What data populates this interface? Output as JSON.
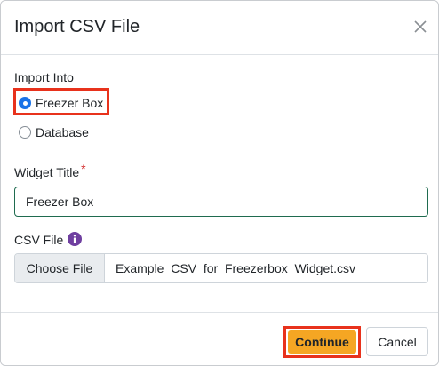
{
  "dialog": {
    "title": "Import CSV File"
  },
  "import_into": {
    "label": "Import Into",
    "options": [
      {
        "label": "Freezer Box",
        "selected": true
      },
      {
        "label": "Database",
        "selected": false
      }
    ]
  },
  "widget_title": {
    "label": "Widget Title",
    "required_mark": "*",
    "value": "Freezer Box"
  },
  "csv_file": {
    "label": "CSV File",
    "info_icon": "info-circle-icon",
    "choose_button": "Choose File",
    "file_name": "Example_CSV_for_Freezerbox_Widget.csv"
  },
  "footer": {
    "continue_label": "Continue",
    "cancel_label": "Cancel"
  },
  "colors": {
    "accent": "#1a73e8",
    "primary_button": "#f5a623",
    "highlight": "#e8321c",
    "info_icon": "#6f3fa0",
    "input_border_focus": "#1f6b4f"
  }
}
